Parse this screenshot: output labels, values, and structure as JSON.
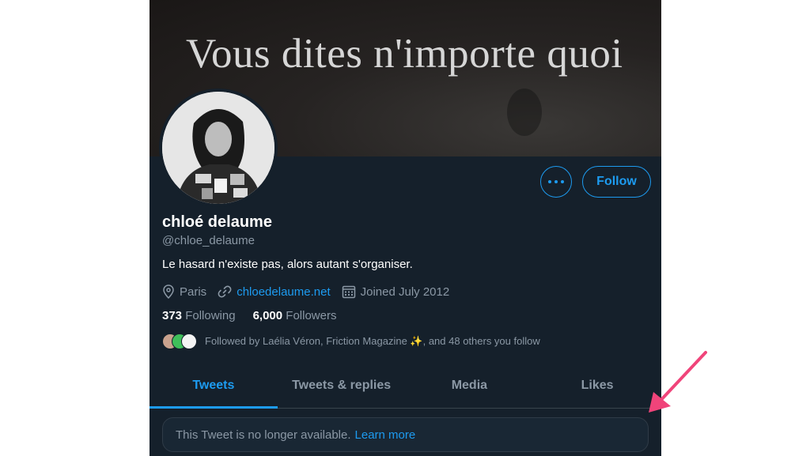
{
  "banner": {
    "text": "Vous dites n'importe quoi"
  },
  "profile": {
    "name": "chloé delaume",
    "handle": "@chloe_delaume",
    "bio": "Le hasard n'existe pas, alors autant s'organiser.",
    "location": "Paris",
    "website": "chloedelaume.net",
    "joined": "Joined July 2012",
    "following_count": "373",
    "following_label": "Following",
    "followers_count": "6,000",
    "followers_label": "Followers",
    "followed_by": "Followed by Laélia Véron, Friction Magazine ✨, and 48 others you follow"
  },
  "actions": {
    "follow_label": "Follow"
  },
  "tabs": [
    {
      "label": "Tweets",
      "active": true
    },
    {
      "label": "Tweets & replies",
      "active": false
    },
    {
      "label": "Media",
      "active": false
    },
    {
      "label": "Likes",
      "active": false
    }
  ],
  "notice": {
    "text": "This Tweet is no longer available.",
    "link": "Learn more"
  },
  "colors": {
    "background": "#15202b",
    "accent": "#1d9bf0",
    "annotation_arrow": "#f0447a"
  },
  "icons": [
    "location-pin-icon",
    "link-icon",
    "calendar-icon",
    "more-dots-icon",
    "annotation-arrow"
  ]
}
